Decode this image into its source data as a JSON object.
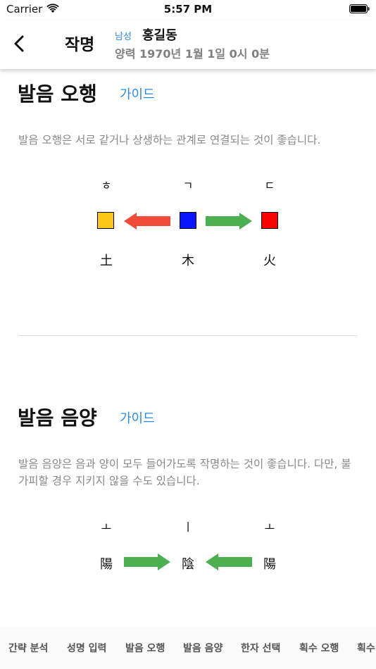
{
  "status_bar": {
    "carrier": "Carrier",
    "time": "5:57 PM"
  },
  "header": {
    "title": "작명",
    "gender": "남성",
    "name": "홍길동",
    "birth": "양력 1970년 1월 1일 0시 0분"
  },
  "pronunciation_five_elements": {
    "title": "발음 오행",
    "guide": "가이드",
    "description": "발음 오행은 서로 같거나 상생하는 관계로 연결되는 것이 좋습니다.",
    "items": [
      {
        "jamo": "ㅎ",
        "element": "土",
        "color": "#ffc61a"
      },
      {
        "jamo": "ㄱ",
        "element": "木",
        "color": "#0a14ff"
      },
      {
        "jamo": "ㄷ",
        "element": "火",
        "color": "#ff0000"
      }
    ],
    "arrow_colors": {
      "conflict": "#f04a38",
      "harmony": "#4caf50"
    }
  },
  "pronunciation_yin_yang": {
    "title": "발음 음양",
    "guide": "가이드",
    "description": "발음 음양은 음과 양이 모두 들어가도록 작명하는 것이 좋습니다. 다만, 불가피할 경우 지키지 않을 수도 있습니다.",
    "items": [
      {
        "jamo": "ㅗ",
        "element": "陽"
      },
      {
        "jamo": "ㅣ",
        "element": "陰"
      },
      {
        "jamo": "ㅗ",
        "element": "陽"
      }
    ]
  },
  "tab_bar": {
    "items": [
      "간략 분석",
      "성명 입력",
      "발음 오행",
      "발음 음양",
      "한자 선택",
      "획수 오행",
      "획수"
    ]
  }
}
